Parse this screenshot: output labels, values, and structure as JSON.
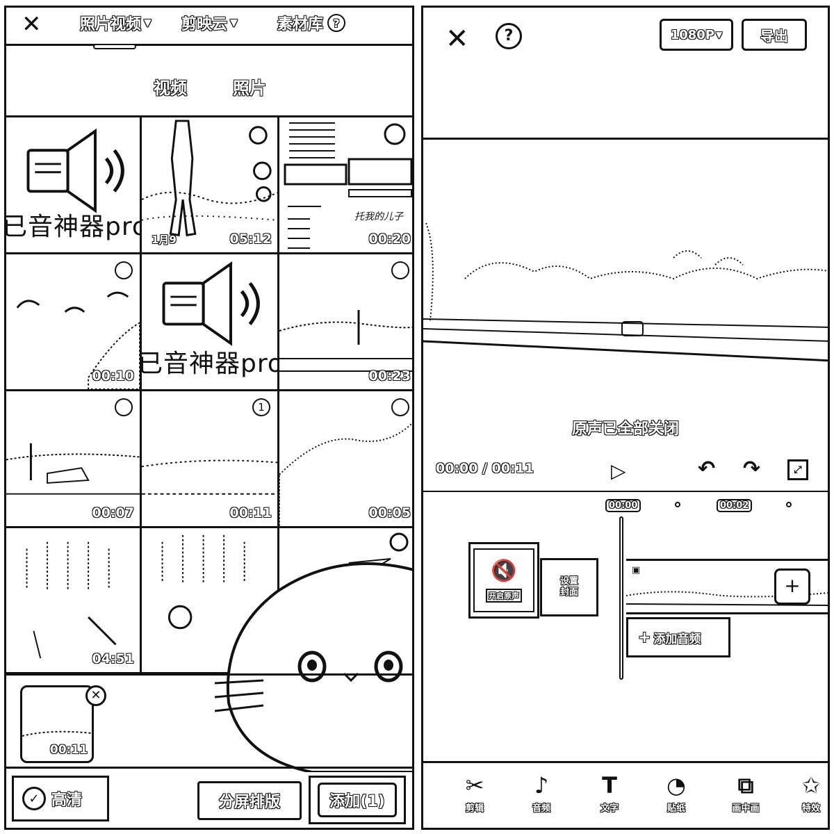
{
  "left": {
    "header": {
      "dropdown_photos_videos": "照片视频",
      "dropdown_jianying_cloud": "剪映云",
      "material_library": "素材库"
    },
    "tabs": [
      {
        "label": "视频"
      },
      {
        "label": "照片"
      }
    ],
    "grid": [
      {
        "kind": "audio",
        "caption": "已音神器pro",
        "duration": ""
      },
      {
        "kind": "video",
        "date": "1月9",
        "duration": "05:12"
      },
      {
        "kind": "doc",
        "mini_title": "托我的儿子",
        "duration": "00:20"
      },
      {
        "kind": "video",
        "duration": "00:10"
      },
      {
        "kind": "audio",
        "caption": "已音神器pro",
        "duration": ""
      },
      {
        "kind": "video",
        "duration": "00:23"
      },
      {
        "kind": "video",
        "duration": "00:07"
      },
      {
        "kind": "video",
        "duration": "00:11",
        "selected_index": "1"
      },
      {
        "kind": "video",
        "duration": "00:05"
      },
      {
        "kind": "video",
        "duration": "04:51"
      },
      {
        "kind": "video",
        "duration": ""
      },
      {
        "kind": "sticker",
        "duration": ""
      }
    ],
    "selected_tray": {
      "duration": "00:11"
    },
    "bottom": {
      "hd_label": "高清",
      "split_label": "分屏排版",
      "add_label": "添加(1)"
    }
  },
  "right": {
    "header": {
      "resolution": "1080P",
      "export": "导出"
    },
    "toast": "原声已全部关闭",
    "controls": {
      "timecode": "00:00 / 00:11"
    },
    "timeline": {
      "ticks": [
        "00:00",
        "00:02"
      ],
      "mute_label": "开启原声",
      "cover_label_1": "设置",
      "cover_label_2": "封面",
      "add_audio": "添加音频"
    },
    "toolbar": [
      {
        "label": "剪辑",
        "icon": "scissors-icon"
      },
      {
        "label": "音频",
        "icon": "music-note-icon"
      },
      {
        "label": "文字",
        "icon": "text-icon"
      },
      {
        "label": "贴纸",
        "icon": "sticker-icon"
      },
      {
        "label": "画中画",
        "icon": "picture-in-picture-icon"
      },
      {
        "label": "特效",
        "icon": "star-effect-icon"
      }
    ]
  }
}
